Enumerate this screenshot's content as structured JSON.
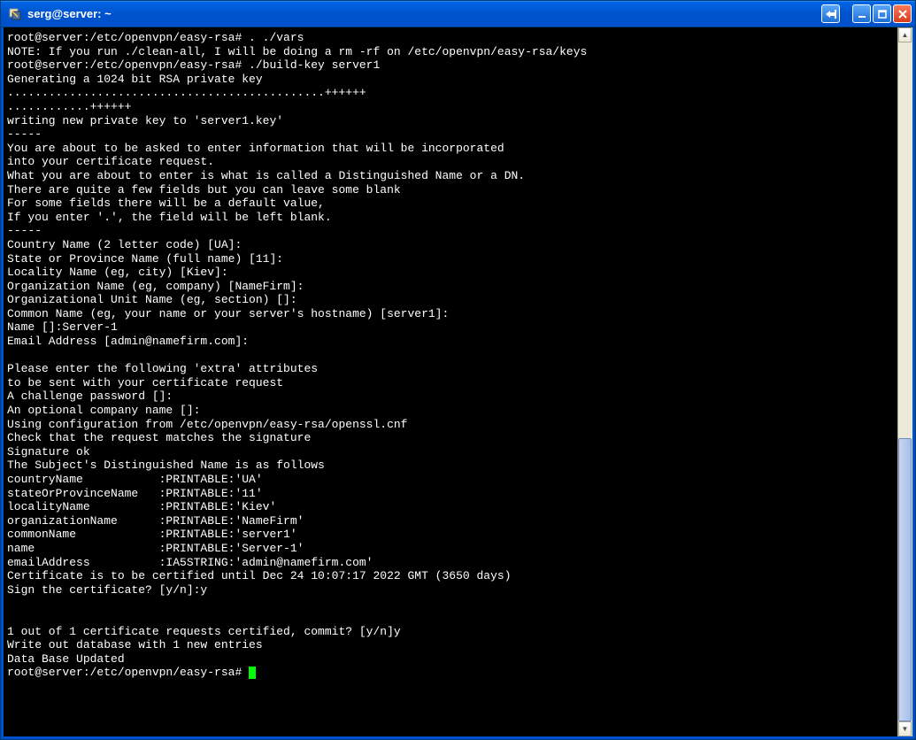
{
  "window": {
    "title": "serg@server: ~"
  },
  "terminal": {
    "lines": [
      "root@server:/etc/openvpn/easy-rsa# . ./vars",
      "NOTE: If you run ./clean-all, I will be doing a rm -rf on /etc/openvpn/easy-rsa/keys",
      "root@server:/etc/openvpn/easy-rsa# ./build-key server1",
      "Generating a 1024 bit RSA private key",
      "..............................................++++++",
      "............++++++",
      "writing new private key to 'server1.key'",
      "-----",
      "You are about to be asked to enter information that will be incorporated",
      "into your certificate request.",
      "What you are about to enter is what is called a Distinguished Name or a DN.",
      "There are quite a few fields but you can leave some blank",
      "For some fields there will be a default value,",
      "If you enter '.', the field will be left blank.",
      "-----",
      "Country Name (2 letter code) [UA]:",
      "State or Province Name (full name) [11]:",
      "Locality Name (eg, city) [Kiev]:",
      "Organization Name (eg, company) [NameFirm]:",
      "Organizational Unit Name (eg, section) []:",
      "Common Name (eg, your name or your server's hostname) [server1]:",
      "Name []:Server-1",
      "Email Address [admin@namefirm.com]:",
      "",
      "Please enter the following 'extra' attributes",
      "to be sent with your certificate request",
      "A challenge password []:",
      "An optional company name []:",
      "Using configuration from /etc/openvpn/easy-rsa/openssl.cnf",
      "Check that the request matches the signature",
      "Signature ok",
      "The Subject's Distinguished Name is as follows",
      "countryName           :PRINTABLE:'UA'",
      "stateOrProvinceName   :PRINTABLE:'11'",
      "localityName          :PRINTABLE:'Kiev'",
      "organizationName      :PRINTABLE:'NameFirm'",
      "commonName            :PRINTABLE:'server1'",
      "name                  :PRINTABLE:'Server-1'",
      "emailAddress          :IA5STRING:'admin@namefirm.com'",
      "Certificate is to be certified until Dec 24 10:07:17 2022 GMT (3650 days)",
      "Sign the certificate? [y/n]:y",
      "",
      "",
      "1 out of 1 certificate requests certified, commit? [y/n]y",
      "Write out database with 1 new entries",
      "Data Base Updated"
    ],
    "prompt": "root@server:/etc/openvpn/easy-rsa# "
  }
}
